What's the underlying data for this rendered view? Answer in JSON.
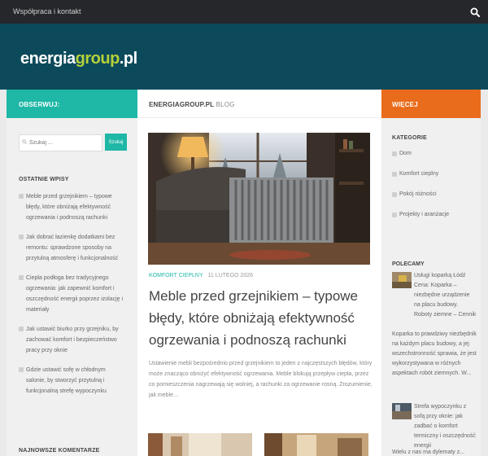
{
  "topbar": {
    "nav_link": "Współpraca i kontakt",
    "search_icon": "search-icon"
  },
  "header": {
    "logo_part1": "energia",
    "logo_part2": "group",
    "logo_part3": ".pl"
  },
  "sidebar_left": {
    "heading": "OBSERWUJ:",
    "search_placeholder": "Szukaj ...",
    "search_button": "Szukaj",
    "recent_title": "OSTATNIE WPISY",
    "recent_posts": [
      "Meble przed grzejnikiem – typowe błędy, które obniżają efektywność ogrzewania i podnoszą rachunki",
      "Jak dobrać łazienkę dodatkami bez remontu: sprawdzone sposoby na przytulną atmosferę i funkcjonalność",
      "Ciepła podłoga bez tradycyjnego ogrzewania: jak zapewnić komfort i oszczędność energii poprzez izolację i materiały",
      "Jak ustawić biurko przy grzejniku, by zachować komfort i bezpieczeństwo pracy przy oknie",
      "Gdzie ustawić sofę w chłodnym salonie, by stworzyć przytulną i funkcjonalną strefę wypoczynku"
    ],
    "comments_title": "NAJNOWSZE KOMENTARZE"
  },
  "main": {
    "site_name": "ENERGIAGROUP.PL",
    "blog_label": "BLOG",
    "post": {
      "category": "KOMFORT CIEPLNY",
      "date": "11 LUTEGO 2026",
      "title": "Meble przed grzejnikiem – typowe błędy, które obniżają efektywność ogrzewania i podnoszą rachunki",
      "excerpt": "Ustawienie mebli bezpośrednio przed grzejnikiem to jeden z najczęstszych błędów, który może znacząco obniżyć efektywność ogrzewania. Meble blokują przepływ ciepła, przez co pomieszczenia nagrzewają się wolniej, a rachunki za ogrzewanie rosną. Zrozumienie, jak meble…"
    }
  },
  "sidebar_right": {
    "heading": "WIĘCEJ",
    "categories_title": "KATEGORIE",
    "categories": [
      "Dom",
      "Komfort cieplny",
      "Pokój różności",
      "Projekty i aranżacje"
    ],
    "recommended_title": "POLECAMY",
    "rec1_text": "Usługi koparką Łódź Cena: Koparka – niezbędne urządzenie na placu budowy. Roboty ziemne – Cennik",
    "rec1_text_b": "Koparka to prawdziwy niezbędnik na każdym placu budowy, a jej wszechstronność sprawia, że jest wykorzystywana w różnych aspektach robót ziemnych. W...",
    "rec2_text": "Strefa wypoczynku z sofą przy oknie: jak zadbać o komfort termiczny i oszczędność energii",
    "rec2_text_b": "Wielu z nas ma dylematy z..."
  },
  "colors": {
    "teal": "#1fb7a6",
    "orange": "#e86c1b",
    "header": "#0c4a5b",
    "topbar": "#26272b",
    "logo_accent": "#b5d03a"
  }
}
